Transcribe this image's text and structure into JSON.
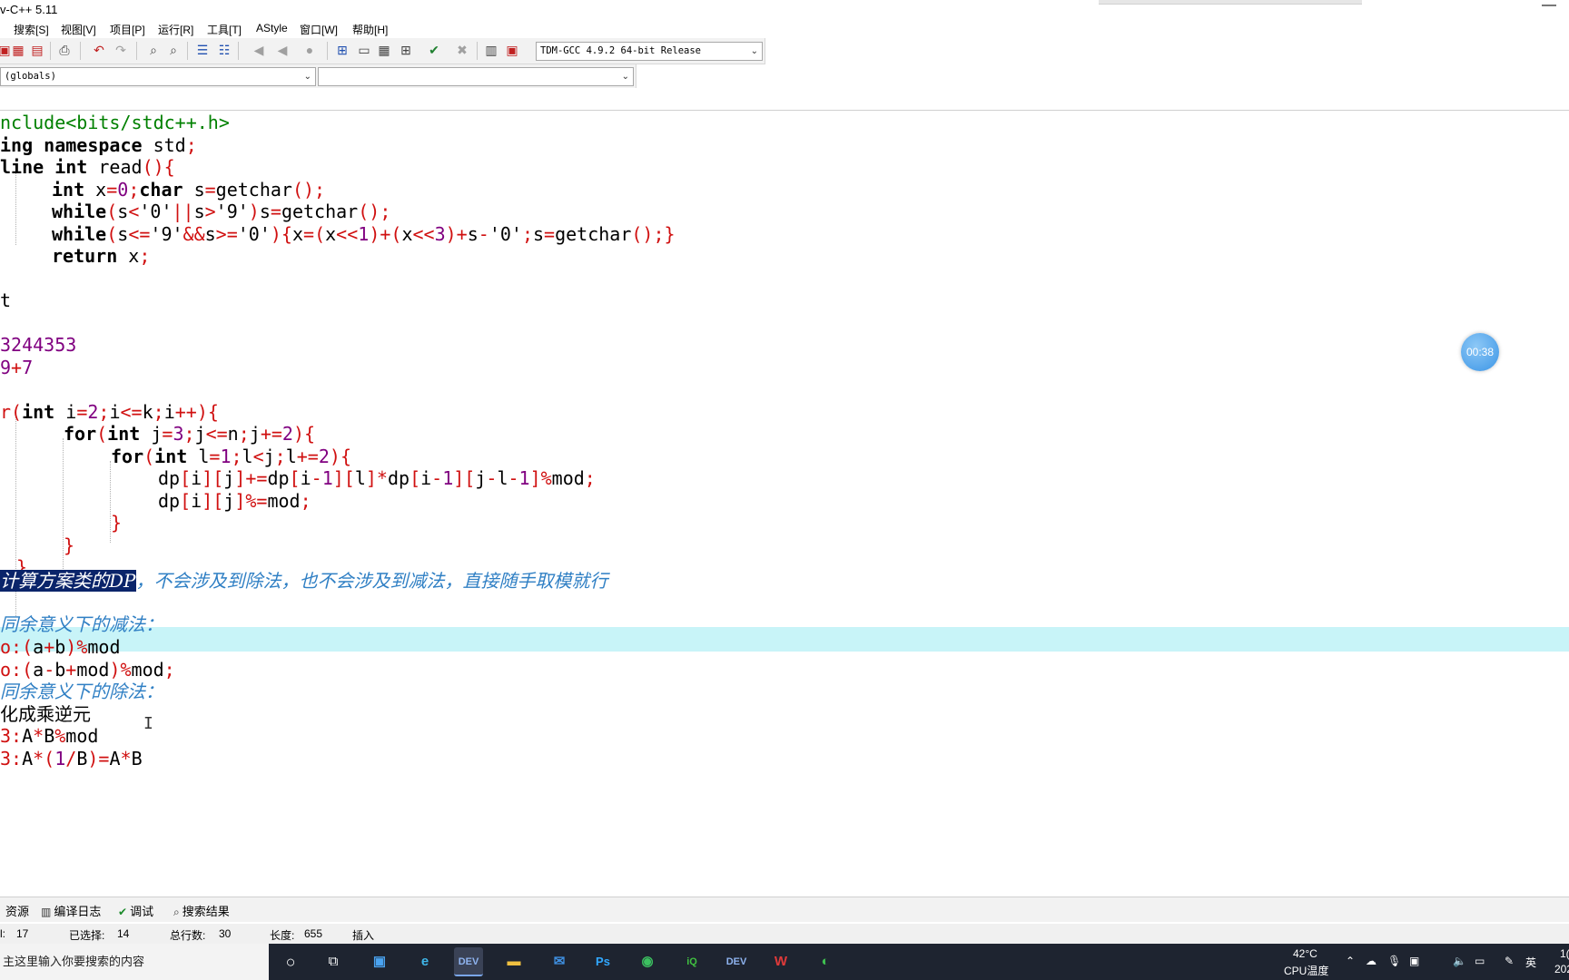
{
  "window": {
    "title": "v-C++ 5.11",
    "minimize": "—"
  },
  "menu": [
    "搜索[S]",
    "视图[V]",
    "项目[P]",
    "运行[R]",
    "工具[T]",
    "AStyle",
    "窗口[W]",
    "帮助[H]"
  ],
  "toolbar": {
    "compiler": "TDM-GCC 4.9.2 64-bit Release"
  },
  "classbar": {
    "scope": "(globals)",
    "member": ""
  },
  "timer": "00:38",
  "code": {
    "l1": "nclude<bits/stdc++.h>",
    "l2a": "ing ",
    "l2b": "namespace",
    "l2c": " std",
    "l2d": ";",
    "l3a": "line ",
    "l3b": "int",
    "l3c": " read",
    "l3d": "(){",
    "l4": "int",
    "l7": "return",
    "l9": "t",
    "n1": "3244353",
    "n2a": "9",
    "n2b": "+",
    "n2c": "7",
    "f1": "int",
    "f2a": "for",
    "f2b": "int",
    "f3a": "for",
    "f3b": "int",
    "c1_sel": "计算方案类的DP",
    "c1_rest": "，不会涉及到除法，也不会涉及到减法，直接随手取模就行",
    "c2": "同余意义下的减法：",
    "m1a": "o:",
    "m1b": "(",
    "m1c": "a",
    "m1d": "+",
    "m1e": "b",
    "m1f": ")%",
    "m1g": "mod",
    "m2a": "o:",
    "m2b": "(",
    "m2c": "a",
    "m2d": "-",
    "m2e": "b",
    "m2f": "+",
    "m2g": "mod",
    "m2h": ")%",
    "m2i": "mod",
    "m2j": ";",
    "c3": "同余意义下的除法：",
    "t1": "化成乘逆元",
    "b1a": "3:",
    "b1b": "A",
    "b1c": "*",
    "b1d": "B",
    "b1e": "%",
    "b1f": "mod",
    "b2a": "3:",
    "b2b": "A",
    "b2c": "*(",
    "b2d": "1",
    "b2e": "/",
    "b2f": "B",
    "b2g": ")=",
    "b2h": "A",
    "b2i": "*",
    "b2j": "B"
  },
  "tabs": [
    "资源",
    "编译日志",
    "调试",
    "搜索结果"
  ],
  "status": {
    "line_label": "l:",
    "line_value": "17",
    "sel_label": "已选择:",
    "sel_value": "14",
    "total_label": "总行数:",
    "total_value": "30",
    "len_label": "长度:",
    "len_value": "655",
    "mode": "插入"
  },
  "taskbar": {
    "search_placeholder": "主这里输入你要搜索的内容",
    "temp": "42°C",
    "temp_label": "CPU温度",
    "ime": "英",
    "clock_top": "1(",
    "clock_bottom": "202"
  }
}
